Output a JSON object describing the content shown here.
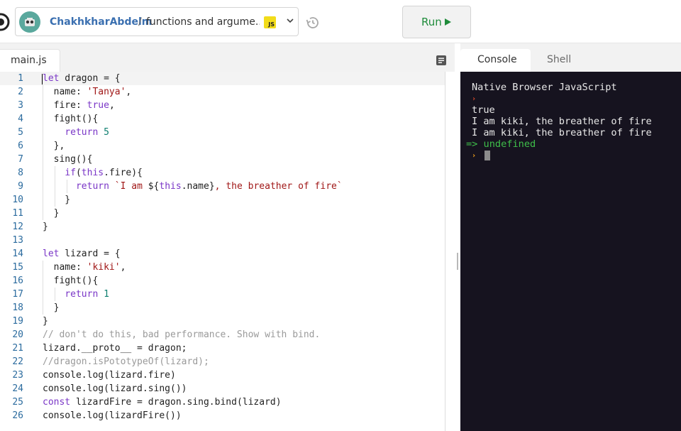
{
  "header": {
    "owner": "ChakhkharAbdelm",
    "separator": "/",
    "repl_name": "functions and argume...",
    "language_badge": "JS",
    "run_label": "Run"
  },
  "editor": {
    "tab_label": "main.js",
    "line_numbers": [
      "1",
      "2",
      "3",
      "4",
      "5",
      "6",
      "7",
      "8",
      "9",
      "10",
      "11",
      "12",
      "13",
      "14",
      "15",
      "16",
      "17",
      "18",
      "19",
      "20",
      "21",
      "22",
      "23",
      "24",
      "25",
      "26"
    ]
  },
  "console": {
    "tab_console": "Console",
    "tab_shell": "Shell",
    "banner": "Native Browser JavaScript",
    "prompt_symbol": "›",
    "output_1": "true",
    "output_2": "I am kiki, the breather of fire",
    "output_3": "I am kiki, the breather of fire",
    "result": "=> undefined"
  },
  "colors": {
    "run_green": "#1f8c3b",
    "console_bg": "#16131f",
    "keyword": "#7a36c7",
    "string": "#a11818",
    "number": "#0d7f6f"
  },
  "icons": [
    "replit-logo-icon",
    "avatar",
    "chevron-down-icon",
    "history-icon",
    "play-icon",
    "format-icon"
  ]
}
